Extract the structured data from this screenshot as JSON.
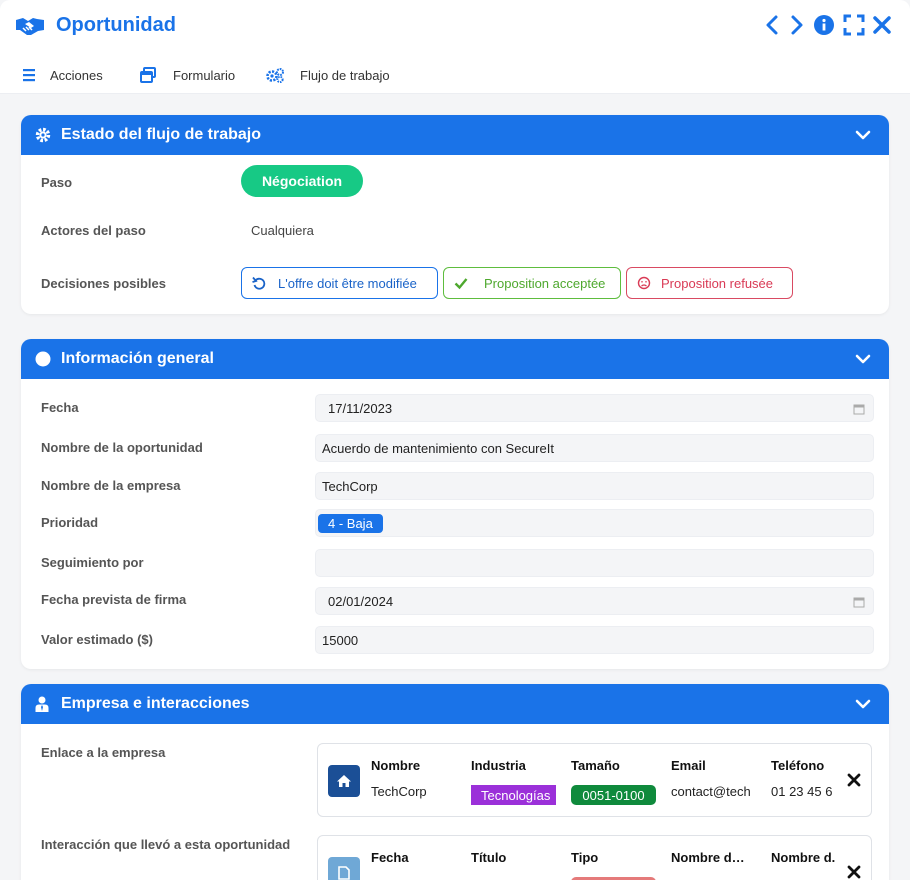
{
  "app": {
    "title": "Oportunidad",
    "accent": "#1a73e8"
  },
  "title_controls": [
    "chevron-left-icon",
    "chevron-right-icon",
    "info-icon",
    "expand-icon",
    "close-icon"
  ],
  "toolbar": {
    "actions_label": "Acciones",
    "form_label": "Formulario",
    "workflow_label": "Flujo de trabajo"
  },
  "workflow_section": {
    "title": "Estado del flujo de trabajo",
    "step_label": "Paso",
    "step_value": "Négociation",
    "actors_label": "Actores del paso",
    "actors_value": "Cualquiera",
    "decisions_label": "Decisiones posibles",
    "decisions": [
      {
        "label": "L'offre doit être modifiée",
        "color": "#1a73e8"
      },
      {
        "label": "Proposition acceptée",
        "color": "#5ebd3e"
      },
      {
        "label": "Proposition refusée",
        "color": "#d94a62"
      }
    ]
  },
  "general_section": {
    "title": "Información general",
    "fields": {
      "date_label": "Fecha",
      "date_value": "17/11/2023",
      "opportunity_label": "Nombre de la oportunidad",
      "opportunity_value": "Acuerdo de mantenimiento con SecureIt",
      "company_label": "Nombre de la empresa",
      "company_value": "TechCorp",
      "priority_label": "Prioridad",
      "priority_value": "4 - Baja",
      "followed_label": "Seguimiento por",
      "followed_value": "",
      "sign_date_label": "Fecha prevista de firma",
      "sign_date_value": "02/01/2024",
      "value_label": "Valor estimado ($)",
      "value_value": "15000"
    }
  },
  "company_section": {
    "title": "Empresa e interacciones",
    "company_link_label": "Enlace a la empresa",
    "company_card": {
      "headers": [
        "Nombre",
        "Industria",
        "Tamaño",
        "Email",
        "Teléfono"
      ],
      "values": [
        "TechCorp",
        "Tecnologías",
        "0051-0100",
        "contact@tech",
        "01 23 45 6"
      ],
      "industry_color": "#9b30d9",
      "size_color": "#0f8a3c"
    },
    "interaction_label": "Interacción que llevó a esta oportunidad",
    "interaction_card": {
      "headers": [
        "Fecha",
        "Título",
        "Tipo",
        "Nombre d…",
        "Nombre d."
      ]
    }
  }
}
